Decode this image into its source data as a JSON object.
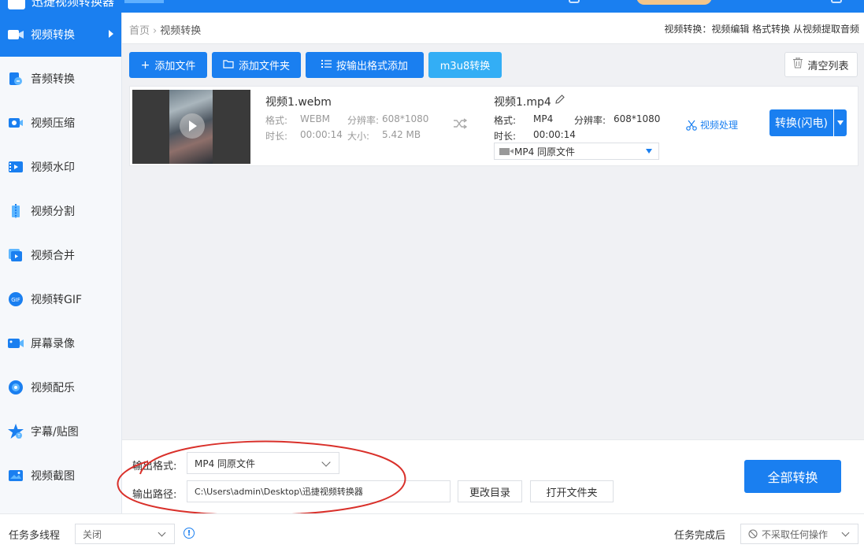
{
  "window": {
    "title_fragment": "迅捷视频转换器"
  },
  "sidebar": {
    "items": [
      {
        "label": "视频转换",
        "icon": "video-convert-icon",
        "active": true
      },
      {
        "label": "音频转换",
        "icon": "audio-convert-icon"
      },
      {
        "label": "视频压缩",
        "icon": "video-compress-icon"
      },
      {
        "label": "视频水印",
        "icon": "video-watermark-icon"
      },
      {
        "label": "视频分割",
        "icon": "video-split-icon"
      },
      {
        "label": "视频合并",
        "icon": "video-merge-icon"
      },
      {
        "label": "视频转GIF",
        "icon": "video-gif-icon"
      },
      {
        "label": "屏幕录像",
        "icon": "screen-record-icon"
      },
      {
        "label": "视频配乐",
        "icon": "video-music-icon"
      },
      {
        "label": "字幕/贴图",
        "icon": "subtitle-sticker-icon"
      },
      {
        "label": "视频截图",
        "icon": "video-screenshot-icon"
      }
    ]
  },
  "breadcrumb": {
    "home": "首页",
    "current": "视频转换"
  },
  "header_links": "视频转换：视频编辑 格式转换 从视频提取音频",
  "toolbar": {
    "add_file": "添加文件",
    "add_folder": "添加文件夹",
    "add_by_format": "按输出格式添加",
    "m3u8": "m3u8转换",
    "clear_list": "清空列表"
  },
  "file": {
    "src_name": "视频1.webm",
    "format_label": "格式:",
    "src_format": "WEBM",
    "resolution_label": "分辨率:",
    "src_resolution": "608*1080",
    "duration_label": "时长:",
    "src_duration": "00:00:14",
    "size_label": "大小:",
    "src_size": "5.42 MB",
    "dst_name": "视频1.mp4",
    "dst_format": "MP4",
    "dst_resolution": "608*1080",
    "dst_duration": "00:00:14",
    "output_format_option": "MP4  同原文件",
    "video_process": "视频处理",
    "convert_button": "转换(闪电)"
  },
  "output": {
    "format_label": "输出格式:",
    "format_value": "MP4  同原文件",
    "path_label": "输出路径:",
    "path_value": "C:\\Users\\admin\\Desktop\\迅捷视频转换器",
    "change_dir": "更改目录",
    "open_folder": "打开文件夹",
    "convert_all": "全部转换"
  },
  "statusbar": {
    "multithread_label": "任务多线程",
    "multithread_value": "关闭",
    "after_complete_label": "任务完成后",
    "after_complete_value": "不采取任何操作"
  },
  "colors": {
    "accent": "#1a7ff0",
    "accent_light": "#33aef5",
    "annotation": "#d9302a"
  }
}
